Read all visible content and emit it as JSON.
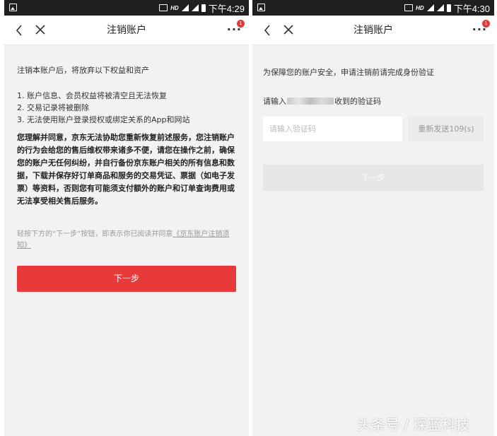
{
  "left": {
    "status": {
      "hd": "HD",
      "time": "下午4:29"
    },
    "nav": {
      "title": "注销账户",
      "more": "···",
      "badge": "1"
    },
    "intro": "注销本账户后，将放弃以下权益和资产",
    "items": [
      "1. 账户信息、会员权益将被清空且无法恢复",
      "2. 交易记录将被删除",
      "3. 无法使用账户登录授权或绑定关系的App和网站"
    ],
    "warning": "您理解并同意，京东无法协助您重新恢复前述服务，您注销账户的行为会给您的售后维权带来诸多不便，请您在操作之前，确保您的账户无任何纠纷，并自行备份京东账户相关的所有信息和数据，下载并保存好订单商品和服务的交易凭证、票据（如电子发票）等资料，否则您有可能须支付额外的账户和订单查询费用或无法享受相关售后服务。",
    "agree_text": "轻按下方的“下一步”按钮，即表示你已阅读并同意",
    "agree_link": "《京东账户注销须知》",
    "next_button": "下一步"
  },
  "right": {
    "status": {
      "hd": "HD",
      "time": "下午4:30"
    },
    "nav": {
      "title": "注销账户",
      "more": "···",
      "badge": "1"
    },
    "notice": "为保障您的账户安全，申请注销前请完成身份验证",
    "enter_prefix": "请输入",
    "enter_suffix": "收到的验证码",
    "code_placeholder": "请输入验证码",
    "resend_button": "重新发送109(s)",
    "next_button": "下一步"
  },
  "watermark": "头条号 / 深蓝科技"
}
